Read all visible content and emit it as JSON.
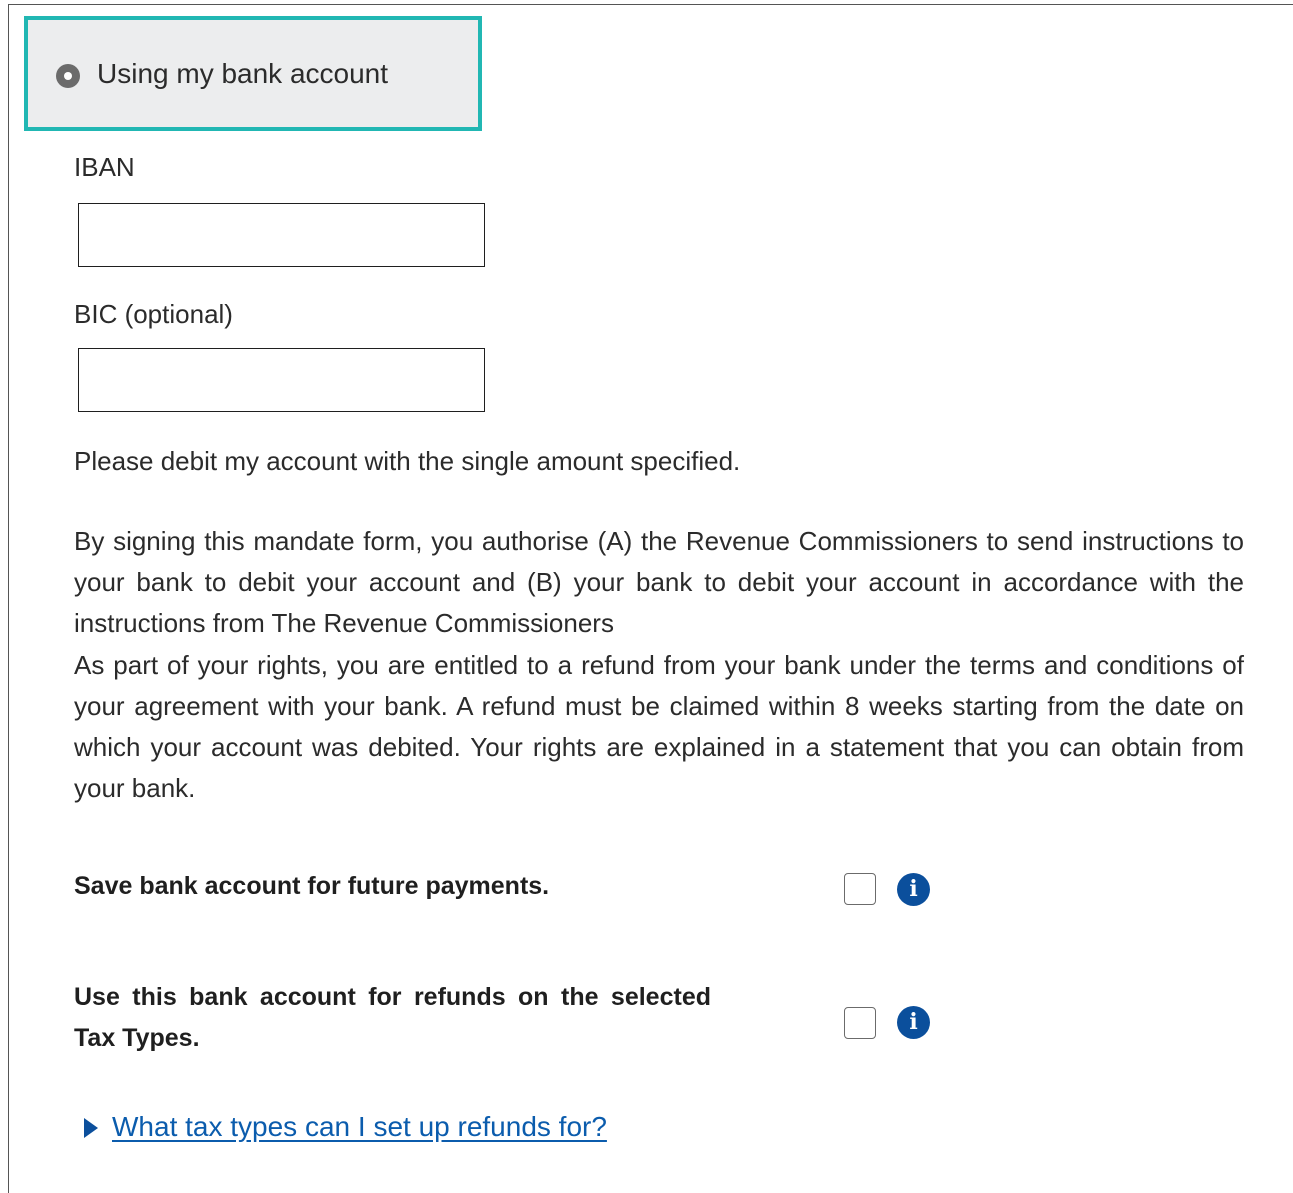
{
  "payment_method": {
    "option_label": "Using my bank account",
    "selected": true
  },
  "fields": {
    "iban_label": "IBAN",
    "iban_value": "",
    "bic_label": "BIC (optional)",
    "bic_value": ""
  },
  "text": {
    "debit_instruction": "Please debit my account with the single amount specified.",
    "mandate_paragraph": "By signing this mandate form, you authorise (A) the Revenue Commissioners to send instructions to your bank to debit your account and (B) your bank to debit your account in accordance with the instructions from The Revenue Commissioners",
    "rights_paragraph": "As part of your rights, you are entitled to a refund from your bank under the terms and conditions of your agreement with your bank. A refund must be claimed within 8 weeks starting from the date on which your account was debited. Your rights are explained in a statement that you can obtain from your bank."
  },
  "options": {
    "save_account_label": "Save bank account for future payments.",
    "save_account_checked": false,
    "refunds_label": "Use this bank account for refunds on the selected Tax Types.",
    "refunds_checked": false
  },
  "disclosure": {
    "label": "What tax types can I set up refunds for?"
  },
  "colors": {
    "selected_border": "#21b7b3",
    "link": "#0b5cad",
    "info_icon": "#0b4f9c"
  }
}
